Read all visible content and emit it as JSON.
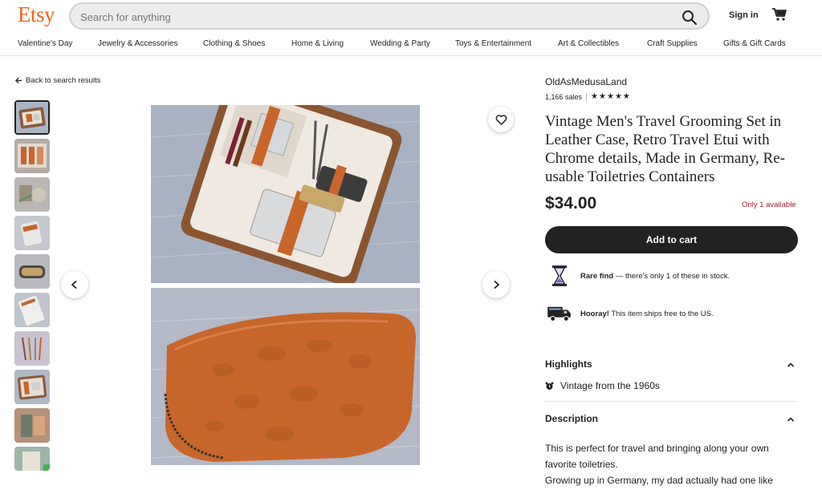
{
  "header": {
    "logo": "Etsy",
    "search_placeholder": "Search for anything",
    "signin": "Sign in"
  },
  "categories": [
    "Valentine's Day",
    "Jewelry & Accessories",
    "Clothing & Shoes",
    "Home & Living",
    "Wedding & Party",
    "Toys & Entertainment",
    "Art & Collectibles",
    "Craft Supplies",
    "Gifts & Gift Cards"
  ],
  "back_link": "Back to search results",
  "listing": {
    "shop_name": "OldAsMedusaLand",
    "sales": "1,166 sales",
    "rating_stars": 5,
    "stars_text": "★★★★★",
    "title": "Vintage Men's Travel Grooming Set in Leather Case, Retro Travel Etui with Chrome details, Made in Germany, Re-usable Toiletries Containers",
    "price": "$34.00",
    "availability": "Only 1 available",
    "add_to_cart": "Add to cart",
    "rare_find_bold": "Rare find",
    "rare_find_text": " — there's only 1 of these in stock.",
    "shipping_bold": "Hooray!",
    "shipping_text": " This item ships free to the US.",
    "highlights_heading": "Highlights",
    "highlight_item": "Vintage from the 1960s",
    "description_heading": "Description",
    "description_line1": "This is perfect for travel and bringing along your own favorite toiletries.",
    "description_line2": "Growing up in Germany, my dad actually had one like"
  },
  "colors": {
    "brand": "#f1641e",
    "leather": "#c8652a",
    "availability": "#a61a2e",
    "button": "#222222"
  },
  "icons": [
    "search-icon",
    "cart-icon",
    "arrow-left-icon",
    "heart-icon",
    "chevron-left-icon",
    "chevron-right-icon",
    "hourglass-icon",
    "truck-icon",
    "alarm-clock-icon",
    "chevron-up-icon"
  ]
}
